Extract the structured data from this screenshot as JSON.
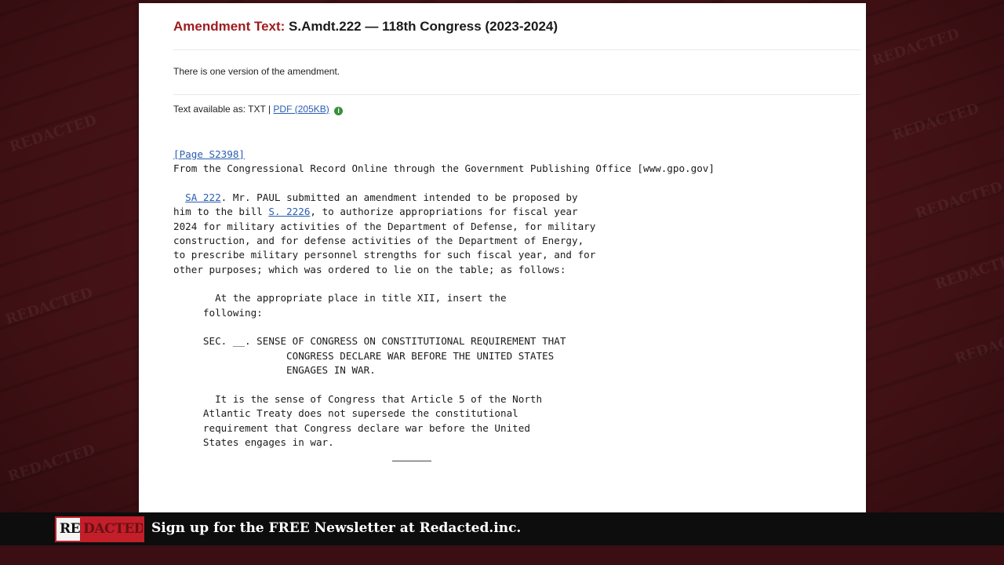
{
  "heading": {
    "label": "Amendment Text:",
    "title": "S.Amdt.222 — 118th Congress (2023-2024)"
  },
  "versions_note": "There is one version of the amendment.",
  "text_available": {
    "prefix": "Text available as: TXT |",
    "pdf_link": "PDF (205KB)",
    "info_icon": "info-circle-icon"
  },
  "record": {
    "page_link": "[Page S2398]",
    "source_line": "From the Congressional Record Online through the Government Publishing Office [www.gpo.gov]",
    "sa_link": "SA 222",
    "para1_a": ". Mr. PAUL submitted an amendment intended to be proposed by\nhim to the bill ",
    "bill_link": "S. 2226",
    "para1_b": ", to authorize appropriations for fiscal year\n2024 for military activities of the Department of Defense, for military\nconstruction, and for defense activities of the Department of Energy,\nto prescribe military personnel strengths for such fiscal year, and for\nother purposes; which was ordered to lie on the table; as follows:",
    "para2": "       At the appropriate place in title XII, insert the\n     following:",
    "section": "     SEC. __. SENSE OF CONGRESS ON CONSTITUTIONAL REQUIREMENT THAT\n                   CONGRESS DECLARE WAR BEFORE THE UNITED STATES\n                   ENGAGES IN WAR.",
    "para3": "       It is the sense of Congress that Article 5 of the North\n     Atlantic Treaty does not supersede the constitutional\n     requirement that Congress declare war before the United\n     States engages in war."
  },
  "banner": {
    "logo_text": "REDACTED",
    "logo_re": "RE",
    "logo_dacted": "DACTED",
    "text": "Sign up for the FREE Newsletter at Redacted.inc."
  },
  "colors": {
    "accent_red": "#9b1c1f",
    "link_blue": "#2a5db0",
    "background": "#4a1418"
  }
}
